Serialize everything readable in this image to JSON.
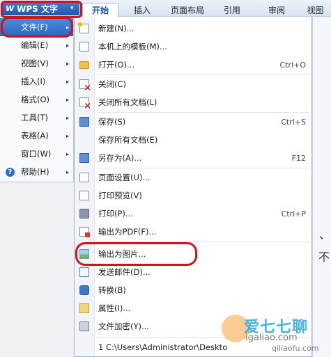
{
  "app": {
    "button_label": "WPS 文字",
    "logo_mark": "W",
    "dropdown_glyph": "▾"
  },
  "ribbon": {
    "tabs": [
      {
        "label": "开始",
        "active": true
      },
      {
        "label": "插入"
      },
      {
        "label": "页面布局"
      },
      {
        "label": "引用"
      },
      {
        "label": "审阅"
      },
      {
        "label": "视图"
      }
    ]
  },
  "left_menu": {
    "items": [
      {
        "label": "文件(F)",
        "selected": true
      },
      {
        "label": "编辑(E)"
      },
      {
        "label": "视图(V)"
      },
      {
        "label": "插入(I)"
      },
      {
        "label": "格式(O)"
      },
      {
        "label": "工具(T)"
      },
      {
        "label": "表格(A)"
      },
      {
        "label": "窗口(W)"
      },
      {
        "label": "帮助(H)",
        "icon": "help-icon"
      }
    ],
    "arrow_glyph": "▸",
    "help_glyph": "?"
  },
  "file_menu": {
    "items": [
      {
        "label": "新建(N)...",
        "icon": "new-document-icon"
      },
      {
        "label": "本机上的模板(M)...",
        "icon": "template-icon"
      },
      {
        "label": "打开(O)...",
        "shortcut": "Ctrl+O",
        "icon": "open-folder-icon"
      },
      {
        "label": "关闭(C)",
        "icon": "close-document-icon"
      },
      {
        "label": "关闭所有文档(L)",
        "icon": "close-all-icon"
      },
      {
        "label": "保存(S)",
        "shortcut": "Ctrl+S",
        "icon": "save-icon"
      },
      {
        "label": "保存所有文档(E)"
      },
      {
        "label": "另存为(A)...",
        "shortcut": "F12",
        "icon": "save-as-icon"
      },
      {
        "label": "页面设置(U)...",
        "icon": "page-setup-icon"
      },
      {
        "label": "打印预览(V)",
        "icon": "print-preview-icon"
      },
      {
        "label": "打印(P)...",
        "shortcut": "Ctrl+P",
        "icon": "printer-icon"
      },
      {
        "label": "输出为PDF(F)...",
        "icon": "pdf-icon"
      },
      {
        "label": "输出为图片...",
        "icon": "picture-icon"
      },
      {
        "label": "发送邮件(D)...",
        "icon": "mail-icon"
      },
      {
        "label": "转换(B)",
        "icon": "convert-icon"
      },
      {
        "label": "属性(I)...",
        "icon": "properties-icon"
      },
      {
        "label": "文件加密(Y)...",
        "icon": "lock-icon"
      },
      {
        "label": "1 C:\\Users\\Administrator\\Deskto"
      }
    ]
  },
  "background": {
    "right_glyph_1": "、",
    "right_glyph_2": "不"
  },
  "watermark": {
    "text": "爱七七聊",
    "url": "igaliao.com",
    "url2": "qiliaofu.com"
  },
  "colors": {
    "accent": "#2b67c0",
    "highlight_ring": "#d1121b",
    "menu_background": "#ffffff",
    "ribbon_background": "#d7e2f1"
  }
}
